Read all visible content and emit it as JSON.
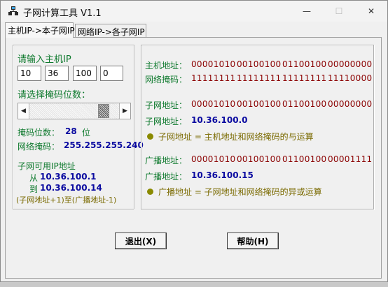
{
  "window": {
    "title": "子网计算工具  V1.1",
    "controls": {
      "minimize": "—",
      "maximize": "☐",
      "close": "✕"
    }
  },
  "tabs": [
    {
      "label": "主机IP->本子网IP"
    },
    {
      "label": "网络IP->各子网IP"
    }
  ],
  "left": {
    "host_ip_label": "请输入主机IP",
    "ip_octets": [
      "10",
      "36",
      "100",
      "0"
    ],
    "mask_select_label": "请选择掩码位数：",
    "slider_value": 28,
    "mask_bits_label": "掩码位数：",
    "mask_bits_value": "28",
    "mask_bits_unit": "位",
    "netmask_label": "网络掩码：",
    "netmask_value": "255.255.255.240",
    "available_label": "子网可用IP地址",
    "from_label": "从",
    "from_value": "10.36.100.1",
    "to_label": "到",
    "to_value": "10.36.100.14",
    "range_note": "(子网地址+1)至(广播地址-1)"
  },
  "right": {
    "host_addr_label": "主机地址：",
    "host_addr_bin": [
      "00001010",
      "00100100",
      "01100100",
      "00000000"
    ],
    "netmask_label": "网络掩码：",
    "netmask_bin": [
      "11111111",
      "11111111",
      "11111111",
      "11110000"
    ],
    "subnet_addr_label": "子网地址：",
    "subnet_addr_bin": [
      "00001010",
      "00100100",
      "01100100",
      "00000000"
    ],
    "subnet_addr_label2": "子网地址：",
    "subnet_addr_value": "10.36.100.0",
    "subnet_note": "子网地址 = 主机地址和网络掩码的与运算",
    "bcast_addr_label": "广播地址：",
    "bcast_addr_bin": [
      "00001010",
      "00100100",
      "01100100",
      "00001111"
    ],
    "bcast_addr_label2": "广播地址：",
    "bcast_addr_value": "10.36.100.15",
    "bcast_note": "广播地址 = 子网地址和网络掩码的异或运算"
  },
  "buttons": {
    "exit": "退出(X)",
    "help": "帮助(H)"
  },
  "colors": {
    "green_label": "#0f7a2e",
    "blue_value": "#0a0aa0",
    "maroon_binary": "#8b0000",
    "olive_note": "#7a6a00"
  }
}
